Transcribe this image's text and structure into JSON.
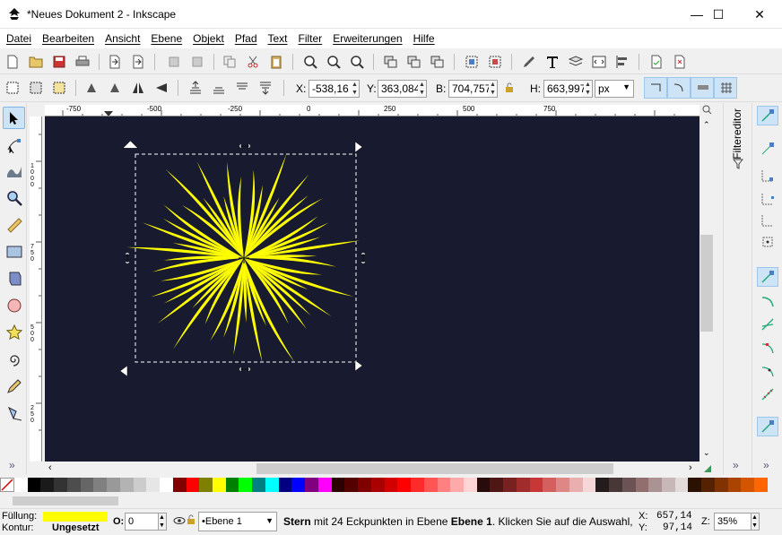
{
  "window": {
    "title": "*Neues Dokument 2 - Inkscape",
    "minimize": "—",
    "maximize": "☐",
    "close": "✕"
  },
  "menu": [
    "Datei",
    "Bearbeiten",
    "Ansicht",
    "Ebene",
    "Objekt",
    "Pfad",
    "Text",
    "Filter",
    "Erweiterungen",
    "Hilfe"
  ],
  "selection_toolbar": {
    "x_label": "X:",
    "x_value": "-538,16",
    "y_label": "Y:",
    "y_value": "363,084",
    "w_label": "B:",
    "w_value": "704,757",
    "h_label": "H:",
    "h_value": "663,997",
    "unit": "px"
  },
  "ruler": {
    "h_ticks": [
      "-750",
      "-500",
      "-250",
      "0",
      "250",
      "500",
      "750"
    ],
    "v_ticks": [
      "1000",
      "750",
      "500",
      "250"
    ]
  },
  "dock": {
    "filter_editor_label": "Filtereditor"
  },
  "colors": {
    "canvas_bg": "#181a30",
    "star_fill": "#ffff00",
    "tool_active": "#cde4f7"
  },
  "palette": [
    "#ffffff",
    "#000000",
    "#1a1a1a",
    "#333333",
    "#4d4d4d",
    "#666666",
    "#808080",
    "#999999",
    "#b3b3b3",
    "#cccccc",
    "#e6e6e6",
    "#ffffff",
    "#800000",
    "#ff0000",
    "#808000",
    "#ffff00",
    "#008000",
    "#00ff00",
    "#008080",
    "#00ffff",
    "#000080",
    "#0000ff",
    "#800080",
    "#ff00ff",
    "#2b0000",
    "#550000",
    "#800000",
    "#aa0000",
    "#d40000",
    "#ff0000",
    "#ff2a2a",
    "#ff5555",
    "#ff8080",
    "#ffaaaa",
    "#ffd5d5",
    "#280b0b",
    "#501616",
    "#782121",
    "#a02c2c",
    "#c83737",
    "#d35f5f",
    "#de8787",
    "#e9afaf",
    "#f4d7d7",
    "#241c1c",
    "#483737",
    "#6c5353",
    "#916f6f",
    "#ac9393",
    "#c8b7b7",
    "#e3dbdb",
    "#2b1100",
    "#552200",
    "#803300",
    "#aa4400",
    "#d45500",
    "#ff6600"
  ],
  "status": {
    "fill_label": "Füllung:",
    "stroke_label": "Kontur:",
    "stroke_value": "Ungesetzt",
    "opacity_label": "O:",
    "opacity_value": "0",
    "layer_value": "•Ebene 1",
    "message_bold": "Stern",
    "message_part1": " mit 24 Eckpunkten in Ebene ",
    "message_layer": "Ebene 1",
    "message_part2": ". Klicken Sie auf die Auswahl, u...",
    "x_label": "X:",
    "x_coord": "657,14",
    "y_label": "Y:",
    "y_coord": "97,14",
    "zoom_label": "Z:",
    "zoom_value": "35%"
  }
}
